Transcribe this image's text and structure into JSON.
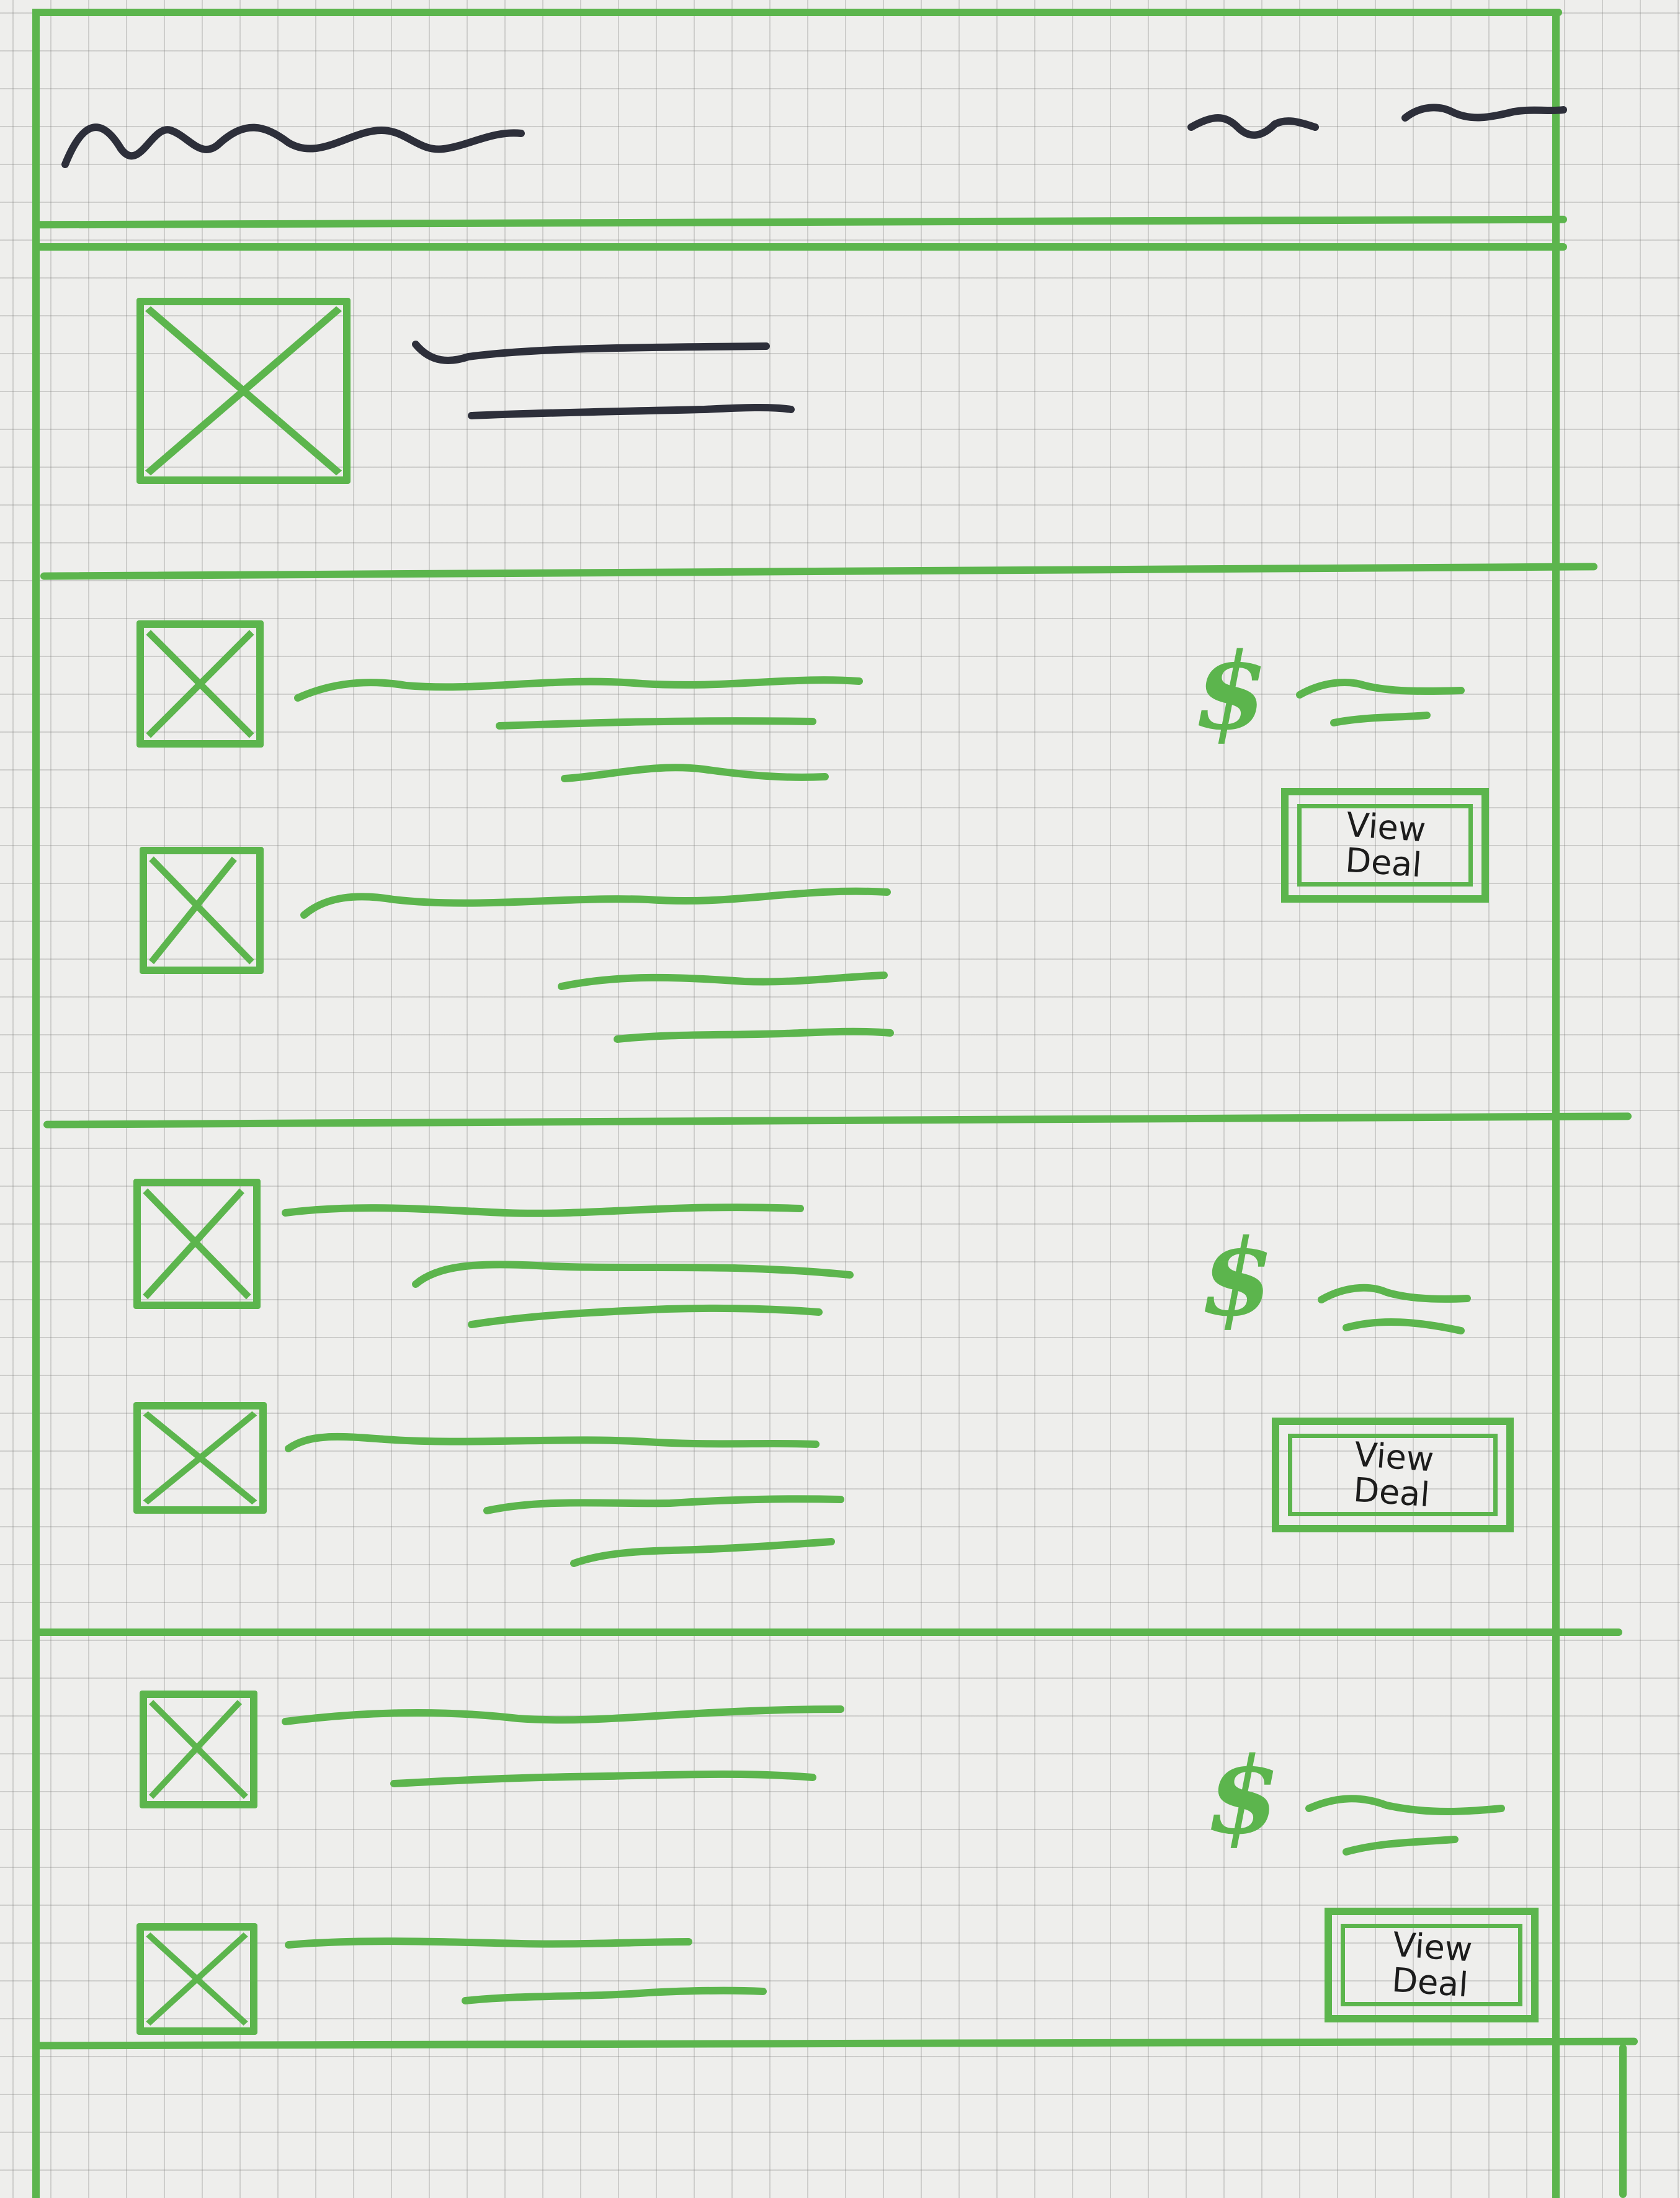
{
  "colors": {
    "sketch_green": "#5cb54d",
    "sketch_ink": "#2d2f3a",
    "paper": "#eeeeec",
    "grid": "#9a9a9a"
  },
  "header": {
    "logo_text": "",
    "nav_items": [
      "",
      ""
    ]
  },
  "featured": {
    "image": "image-placeholder-icon",
    "title_lines": [
      "",
      ""
    ]
  },
  "deals": [
    {
      "price_symbol": "$",
      "button_label": "View\nDeal",
      "items": [
        {
          "image": "image-placeholder-icon"
        },
        {
          "image": "image-placeholder-icon"
        }
      ]
    },
    {
      "price_symbol": "$",
      "button_label": "View\nDeal",
      "items": [
        {
          "image": "image-placeholder-icon"
        },
        {
          "image": "image-placeholder-icon"
        }
      ]
    },
    {
      "price_symbol": "$",
      "button_label": "View\nDeal",
      "items": [
        {
          "image": "image-placeholder-icon"
        },
        {
          "image": "image-placeholder-icon"
        }
      ]
    }
  ]
}
